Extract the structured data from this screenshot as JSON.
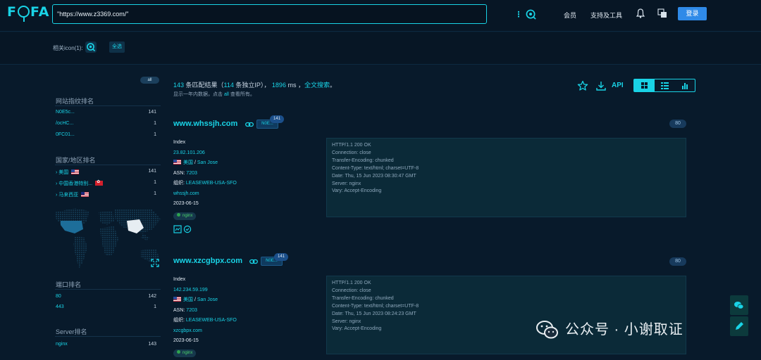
{
  "brand": {
    "logo": "FOFA"
  },
  "search": {
    "query": "\"https://www.z3369.com/\""
  },
  "nav": {
    "membership": "会员",
    "support": "支持及工具",
    "login": "登录"
  },
  "subbar": {
    "related_icon_label": "相关icon(1):",
    "all_tag": "全选"
  },
  "sidebar": {
    "all_label": "all",
    "website_fingerprint": {
      "title": "网站指纹排名",
      "items": [
        {
          "name": "N0E5c...",
          "count": "141"
        },
        {
          "name": "/ocHC...",
          "count": "1"
        },
        {
          "name": "0FC01...",
          "count": "1"
        }
      ]
    },
    "country": {
      "title": "国家/地区排名",
      "items": [
        {
          "name": "美国",
          "count": "141",
          "flag": "us"
        },
        {
          "name": "中国香港特别...",
          "count": "1",
          "flag": "hk"
        },
        {
          "name": "马来西亚",
          "count": "1",
          "flag": "my"
        }
      ]
    },
    "port": {
      "title": "端口排名",
      "items": [
        {
          "name": "80",
          "count": "142"
        },
        {
          "name": "443",
          "count": "1"
        }
      ]
    },
    "server": {
      "title": "Server排名",
      "items": [
        {
          "name": "nginx",
          "count": "143"
        }
      ]
    }
  },
  "summary": {
    "total": "143",
    "t1": " 条匹配结果（",
    "ips": "114",
    "t2": " 条独立IP）， ",
    "ms": "1896",
    "t3": " ms ，",
    "fulltext": "全文搜索",
    "t4": "。",
    "note_a": "显示一年内数据，点击 ",
    "note_all": "all",
    "note_b": " 查看所有。"
  },
  "toolbar": {
    "api_label": "API"
  },
  "results": [
    {
      "host": "www.whssjh.com",
      "tag": "N0E...",
      "count": "141",
      "port": "80",
      "title": "Index",
      "ip": "23.82.101.206",
      "country": "美国",
      "city": "San Jose",
      "asn_label": "ASN:",
      "asn": "7203",
      "org_label": "组织:",
      "org": "LEASEWEB-USA-SFO",
      "domain": "whssjh.com",
      "date": "2023-06-15",
      "server": "nginx",
      "response": "HTTP/1.1 200 OK\nConnection: close\nTransfer-Encoding: chunked\nContent-Type: text/html; charset=UTF-8\nDate: Thu, 15 Jun 2023 08:30:47 GMT\nServer: nginx\nVary: Accept-Encoding"
    },
    {
      "host": "www.xzcgbpx.com",
      "tag": "N0E...",
      "count": "141",
      "port": "80",
      "title": "Index",
      "ip": "142.234.59.199",
      "country": "美国",
      "city": "San Jose",
      "asn_label": "ASN:",
      "asn": "7203",
      "org_label": "组织:",
      "org": "LEASEWEB-USA-SFO",
      "domain": "xzcgbpx.com",
      "date": "2023-06-15",
      "server": "nginx",
      "response": "HTTP/1.1 200 OK\nConnection: close\nTransfer-Encoding: chunked\nContent-Type: text/html; charset=UTF-8\nDate: Thu, 15 Jun 2023 08:24:23 GMT\nServer: nginx\nVary: Accept-Encoding"
    }
  ],
  "watermark": {
    "text": "公众号 · 小谢取证"
  },
  "colors": {
    "background": "#081a2b",
    "accent": "#19d3e6",
    "login": "#2f8ae8"
  }
}
